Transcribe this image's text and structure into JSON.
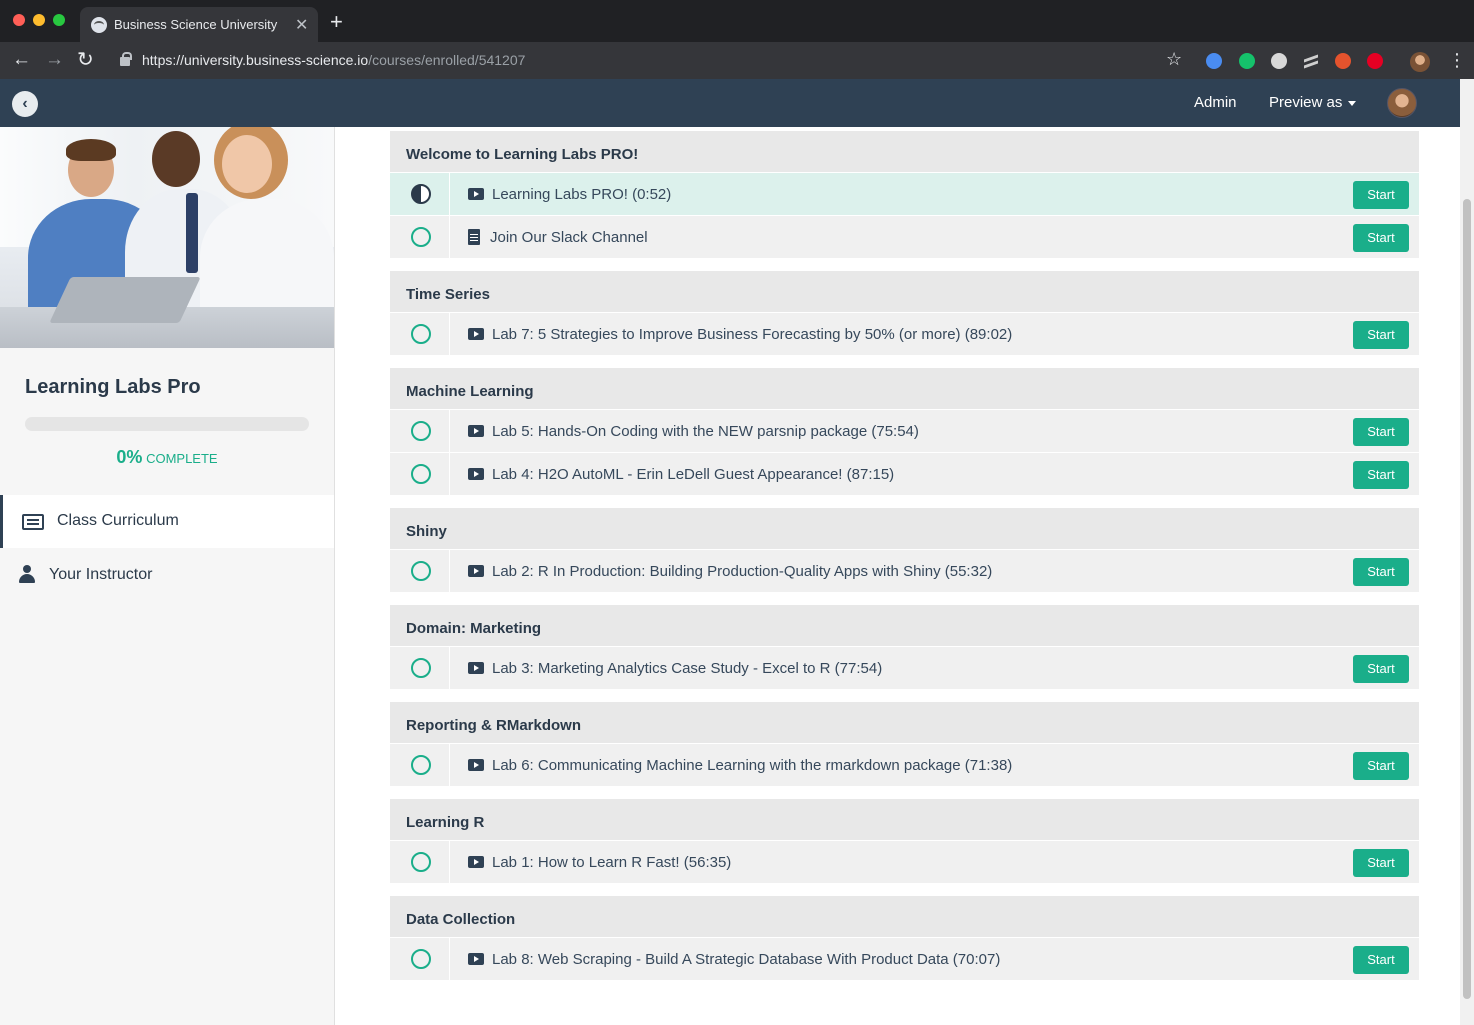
{
  "browser": {
    "tab_title": "Business Science University",
    "url_main": "https://university.business-science.io",
    "url_path": "/courses/enrolled/541207"
  },
  "header": {
    "admin_label": "Admin",
    "preview_label": "Preview as"
  },
  "sidebar": {
    "course_title": "Learning Labs Pro",
    "progress_percent": "0%",
    "progress_value": 0,
    "progress_suffix": "COMPLETE",
    "nav": [
      {
        "label": "Class Curriculum",
        "icon": "list-icon",
        "active": true
      },
      {
        "label": "Your Instructor",
        "icon": "user-icon",
        "active": false
      }
    ]
  },
  "colors": {
    "accent": "#1aae8a",
    "header_bg": "#2f4154",
    "current_row": "#dcf1ec"
  },
  "curriculum": {
    "button_label": "Start",
    "sections": [
      {
        "title": "Welcome to Learning Labs PRO!",
        "lectures": [
          {
            "title": "Learning Labs PRO! (0:52)",
            "type": "video",
            "status": "in-progress"
          },
          {
            "title": "Join Our Slack Channel",
            "type": "document",
            "status": "not-started"
          }
        ]
      },
      {
        "title": "Time Series",
        "lectures": [
          {
            "title": "Lab 7: 5 Strategies to Improve Business Forecasting by 50% (or more) (89:02)",
            "type": "video",
            "status": "not-started"
          }
        ]
      },
      {
        "title": "Machine Learning",
        "lectures": [
          {
            "title": "Lab 5: Hands-On Coding with the NEW parsnip package (75:54)",
            "type": "video",
            "status": "not-started"
          },
          {
            "title": "Lab 4: H2O AutoML - Erin LeDell Guest Appearance! (87:15)",
            "type": "video",
            "status": "not-started"
          }
        ]
      },
      {
        "title": "Shiny",
        "lectures": [
          {
            "title": "Lab 2: R In Production: Building Production-Quality Apps with Shiny (55:32)",
            "type": "video",
            "status": "not-started"
          }
        ]
      },
      {
        "title": "Domain: Marketing",
        "lectures": [
          {
            "title": "Lab 3: Marketing Analytics Case Study - Excel to R (77:54)",
            "type": "video",
            "status": "not-started"
          }
        ]
      },
      {
        "title": "Reporting & RMarkdown",
        "lectures": [
          {
            "title": "Lab 6: Communicating Machine Learning with the rmarkdown package (71:38)",
            "type": "video",
            "status": "not-started"
          }
        ]
      },
      {
        "title": "Learning R",
        "lectures": [
          {
            "title": "Lab 1: How to Learn R Fast! (56:35)",
            "type": "video",
            "status": "not-started"
          }
        ]
      },
      {
        "title": "Data Collection",
        "lectures": [
          {
            "title": "Lab 8: Web Scraping - Build A Strategic Database With Product Data (70:07)",
            "type": "video",
            "status": "not-started"
          }
        ]
      }
    ]
  }
}
